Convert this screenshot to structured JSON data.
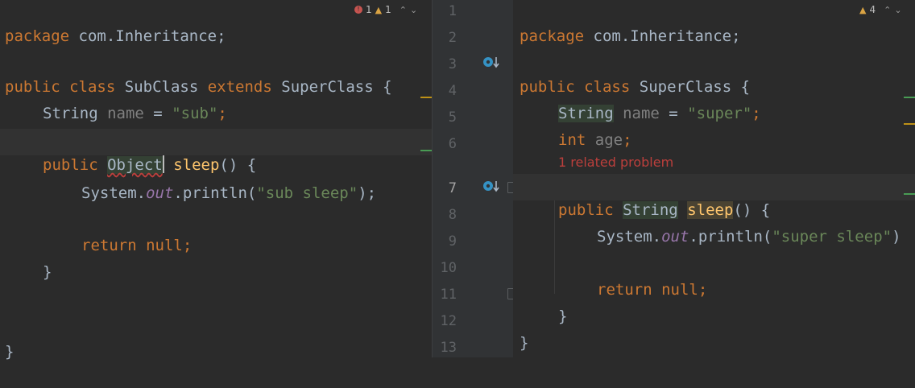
{
  "left": {
    "badge": {
      "errors": "1",
      "warnings": "1"
    },
    "lines": {
      "package": {
        "kw": "package",
        "rest": " com.Inheritance;"
      },
      "class_decl": {
        "kw1": "public",
        "kw2": "class",
        "name": "SubClass",
        "kw3": "extends",
        "super": "SuperClass {"
      },
      "field": {
        "type": "String",
        "name": "name",
        "eq": " = ",
        "value": "\"sub\"",
        "semi": ";"
      },
      "method": {
        "kw": "public",
        "rtype": "Object",
        "name": "sleep",
        "rest": "() {"
      },
      "println": {
        "pre": "System.",
        "field": "out",
        "call": ".println(",
        "arg": "\"sub sleep\"",
        "end": ");"
      },
      "ret": {
        "kw": "return null",
        "semi": ";"
      },
      "close_method": "}",
      "close_class": "}"
    }
  },
  "right": {
    "badge": {
      "warnings": "4"
    },
    "line_numbers": [
      "1",
      "2",
      "3",
      "4",
      "5",
      "6",
      "7",
      "8",
      "9",
      "10",
      "11",
      "12",
      "13"
    ],
    "problem_note": "1 related problem",
    "lines": {
      "package": {
        "kw": "package",
        "rest": " com.Inheritance;"
      },
      "class_decl": {
        "kw1": "public",
        "kw2": "class",
        "name": "SuperClass {"
      },
      "field1": {
        "type": "String",
        "name": "name",
        "eq": " = ",
        "value": "\"super\"",
        "semi": ";"
      },
      "field2": {
        "type": "int",
        "name": "age",
        "semi": ";"
      },
      "method": {
        "kw": "public",
        "rtype": "String",
        "name": "sleep",
        "rest": "() {"
      },
      "println": {
        "pre": "System.",
        "field": "out",
        "call": ".println(",
        "arg": "\"super sleep\"",
        "end": ")"
      },
      "ret": {
        "kw": "return null",
        "semi": ";"
      },
      "close_method": "}",
      "close_class": "}"
    }
  },
  "colors": {
    "keyword": "#cc7832",
    "string": "#6a8759",
    "field": "#9876aa",
    "method": "#ffc66d",
    "error": "#bc3f3c",
    "warning": "#be9117",
    "added": "#499c54"
  },
  "icons": {
    "override_gutter": "overridden-method-icon",
    "implement_gutter": "implemented-method-icon",
    "error": "error-icon",
    "warning": "warning-icon"
  }
}
